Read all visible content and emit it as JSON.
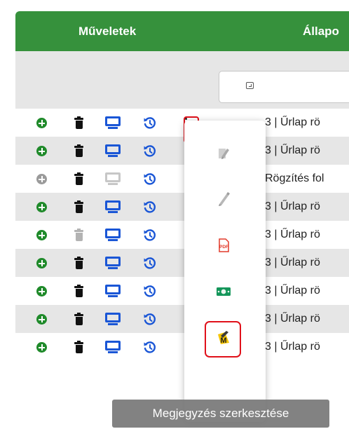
{
  "table": {
    "headers": {
      "actions": "Műveletek",
      "status": "Állapo"
    },
    "rows": [
      {
        "status": "3 | Űrlap rö",
        "plus_enabled": true,
        "trash_enabled": true,
        "monitor_enabled": true
      },
      {
        "status": "3 | Űrlap rö",
        "plus_enabled": true,
        "trash_enabled": true,
        "monitor_enabled": true
      },
      {
        "status": "Rögzítés fol",
        "plus_enabled": false,
        "trash_enabled": true,
        "monitor_enabled": false
      },
      {
        "status": "3 | Űrlap rö",
        "plus_enabled": true,
        "trash_enabled": true,
        "monitor_enabled": true
      },
      {
        "status": "3 | Űrlap rö",
        "plus_enabled": true,
        "trash_enabled": false,
        "monitor_enabled": true
      },
      {
        "status": "3 | Űrlap rö",
        "plus_enabled": true,
        "trash_enabled": true,
        "monitor_enabled": true
      },
      {
        "status": "3 | Űrlap rö",
        "plus_enabled": true,
        "trash_enabled": true,
        "monitor_enabled": true
      },
      {
        "status": "3 | Űrlap rö",
        "plus_enabled": true,
        "trash_enabled": true,
        "monitor_enabled": true
      },
      {
        "status": "3 | Űrlap rö",
        "plus_enabled": true,
        "trash_enabled": true,
        "monitor_enabled": true
      }
    ]
  },
  "row_icons": [
    "plus-circle-icon",
    "trash-icon",
    "monitor-icon",
    "history-icon",
    "kebab-menu-icon"
  ],
  "dropdown": {
    "items": [
      {
        "icon": "document-sign-icon",
        "enabled": false
      },
      {
        "icon": "pen-icon",
        "enabled": false
      },
      {
        "icon": "pdf-icon",
        "enabled": true
      },
      {
        "icon": "money-icon",
        "enabled": true
      },
      {
        "icon": "note-edit-icon",
        "enabled": true,
        "highlighted": true
      }
    ]
  },
  "tooltip": {
    "text": "Megjegyzés szerkesztése"
  },
  "colors": {
    "header": "#36913c",
    "action_green": "#1f8a2a",
    "action_blue": "#1a56d6",
    "disabled": "#b3b3b3",
    "highlight_red": "#e0101a",
    "row_alt": "#e6e6e6"
  }
}
